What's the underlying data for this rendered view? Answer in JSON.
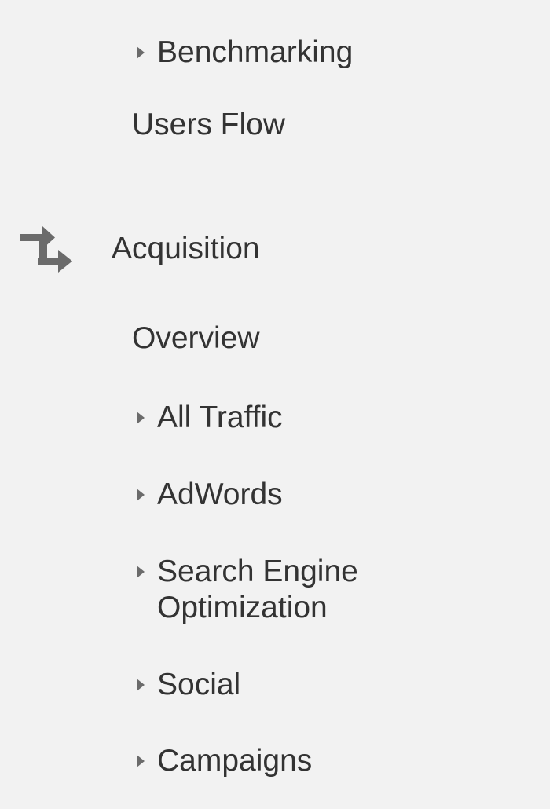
{
  "colors": {
    "background": "#f2f2f2",
    "text": "#333333",
    "icon": "#6b6b6b"
  },
  "nav": {
    "benchmarking": {
      "label": "Benchmarking",
      "icon": "caret-right-icon"
    },
    "users_flow": {
      "label": "Users Flow"
    },
    "acquisition": {
      "label": "Acquisition",
      "icon": "acquisition-arrows-icon"
    },
    "acquisition_items": [
      {
        "label": "Overview"
      },
      {
        "label": "All Traffic",
        "icon": "caret-right-icon"
      },
      {
        "label": "AdWords",
        "icon": "caret-right-icon"
      },
      {
        "label": "Search Engine Optimization",
        "icon": "caret-right-icon"
      },
      {
        "label": "Social",
        "icon": "caret-right-icon"
      },
      {
        "label": "Campaigns",
        "icon": "caret-right-icon"
      }
    ]
  }
}
